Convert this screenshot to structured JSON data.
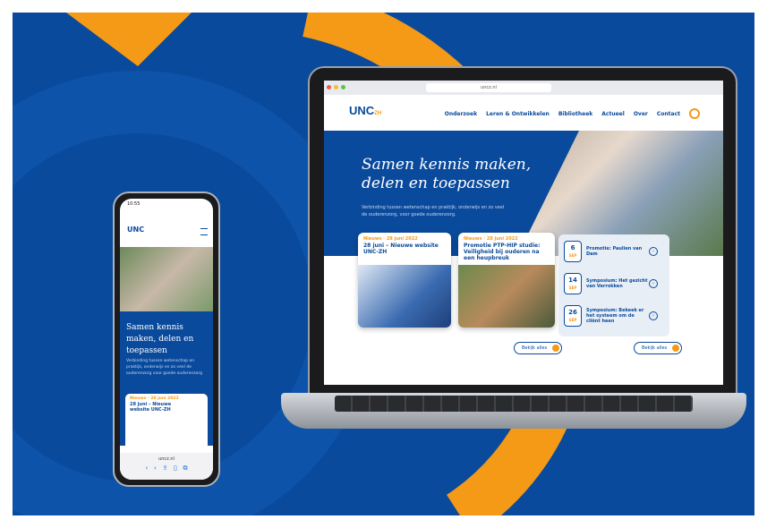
{
  "colors": {
    "brand_blue": "#0a4a9c",
    "accent_orange": "#f49a17"
  },
  "laptop": {
    "browser": {
      "url": "uncz.nl"
    },
    "site": {
      "logo": "UNC",
      "logo_suffix": "ZH",
      "nav": [
        "Onderzoek",
        "Leren & Ontwikkelen",
        "Bibliotheek",
        "Actueel",
        "Over",
        "Contact"
      ],
      "hero_title": "Samen kennis maken, delen en toepassen",
      "hero_text": "Verbinding tussen wetenschap en praktijk, onderwijs en zo veel de ouderenzorg, voor goede ouderenzorg.",
      "news": [
        {
          "meta": "Nieuws · 28 juni 2022",
          "title": "28 juni – Nieuwe website UNC-ZH"
        },
        {
          "meta": "Nieuws · 28 juni 2022",
          "title": "Promotie PTP-HIP studie: Veiligheid bij ouderen na een heupbreuk"
        }
      ],
      "events": [
        {
          "day": "6",
          "month": "SEP",
          "title": "Promotie: Paulien van Dam"
        },
        {
          "day": "14",
          "month": "SEP",
          "title": "Symposium: Het gezicht van Verrokken"
        },
        {
          "day": "26",
          "month": "SEP",
          "title": "Symposium: Bekeek er het systeem om de cliënt heen"
        }
      ],
      "more_news": "Bekijk alles",
      "more_events": "Bekijk alles"
    }
  },
  "phone": {
    "status_time": "10:55",
    "logo": "UNC",
    "hero_title": "Samen kennis maken, delen en toepassen",
    "hero_text": "Verbinding tussen wetenschap en praktijk, onderwijs en zo veel de ouderenzorg voor goede ouderenzorg",
    "card_meta": "Nieuws · 28 juni 2022",
    "card_title": "28 juni – Nieuwe website UNC-ZH",
    "url": "uncz.nl"
  }
}
